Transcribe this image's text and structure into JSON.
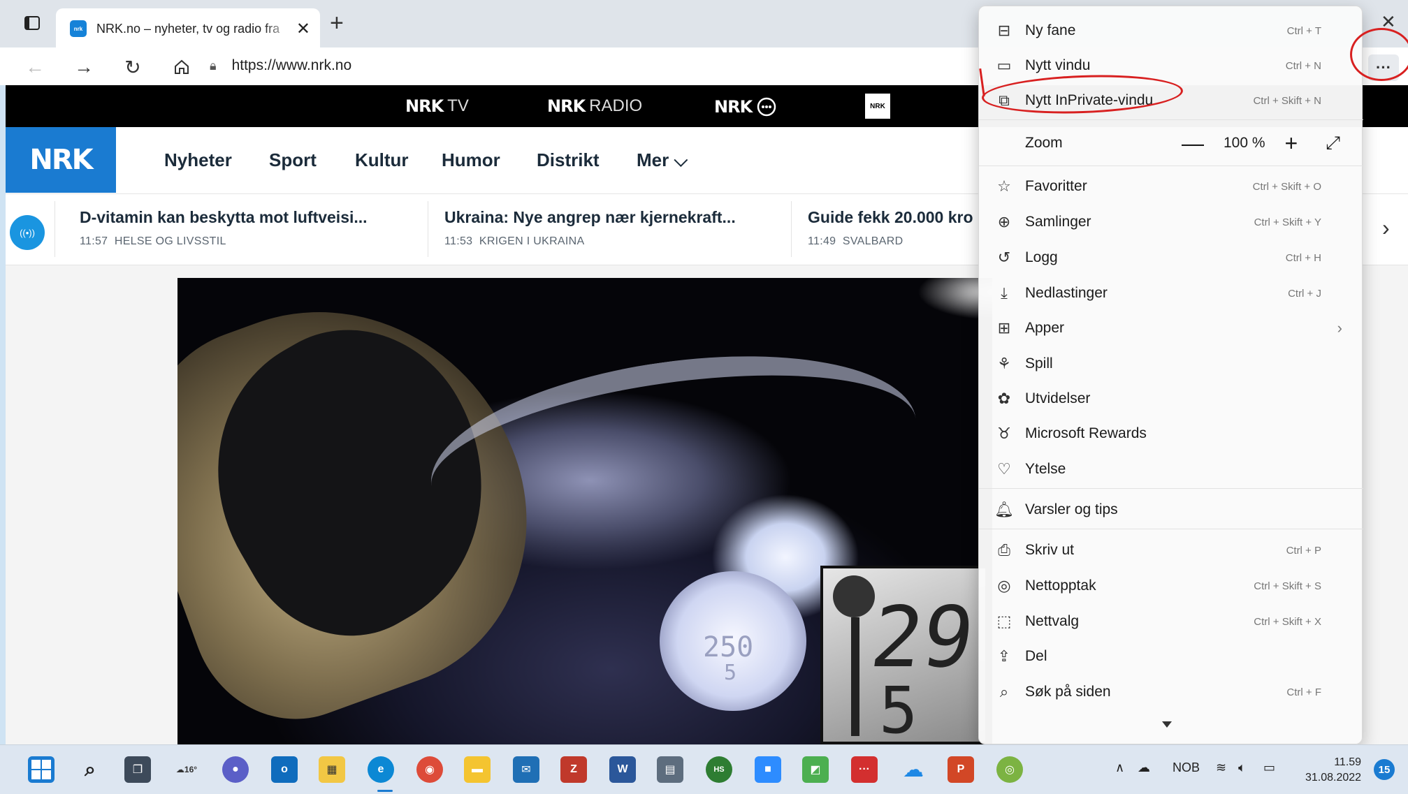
{
  "browser": {
    "tab_title": "NRK.no – nyheter, tv og radio fra",
    "url": "https://www.nrk.no",
    "more_label": "···",
    "new_tab_glyph": "+",
    "close_glyph": "✕"
  },
  "nrk_strip": {
    "tv": {
      "brand": "NRK",
      "label": "TV"
    },
    "radio": {
      "brand": "NRK",
      "label": "RADIO"
    },
    "super": {
      "brand": "NRK"
    }
  },
  "nrk_nav": {
    "logo": "NRK",
    "items": [
      "Nyheter",
      "Sport",
      "Kultur",
      "Humor",
      "Distrikt",
      "Mer ⌵"
    ]
  },
  "ticker": {
    "items": [
      {
        "headline": "D-vitamin kan beskytta mot luftveisi...",
        "time": "11:57",
        "category": "HELSE OG LIVSSTIL"
      },
      {
        "headline": "Ukraina: Nye angrep nær kjernekraft...",
        "time": "11:53",
        "category": "KRIGEN I UKRAINA"
      },
      {
        "headline": "Guide fekk 20.000 kro",
        "time": "11:49",
        "category": "SVALBARD"
      }
    ]
  },
  "video": {
    "lcd_speed": "29",
    "lcd_gear": "5",
    "inner_speed": "250",
    "inner_gear": "5"
  },
  "menu": {
    "items": [
      {
        "icon": "new-tab-icon",
        "label": "Ny fane",
        "shortcut": "Ctrl + T"
      },
      {
        "icon": "new-window-icon",
        "label": "Nytt vindu",
        "shortcut": "Ctrl + N"
      },
      {
        "icon": "inprivate-icon",
        "label": "Nytt InPrivate-vindu",
        "shortcut": "Ctrl + Skift + N"
      },
      {
        "icon": "",
        "label": "Zoom",
        "shortcut": ""
      },
      {
        "icon": "favorites-icon",
        "label": "Favoritter",
        "shortcut": "Ctrl + Skift + O"
      },
      {
        "icon": "collections-icon",
        "label": "Samlinger",
        "shortcut": "Ctrl + Skift + Y"
      },
      {
        "icon": "history-icon",
        "label": "Logg",
        "shortcut": "Ctrl + H"
      },
      {
        "icon": "downloads-icon",
        "label": "Nedlastinger",
        "shortcut": "Ctrl + J"
      },
      {
        "icon": "apps-icon",
        "label": "Apper",
        "shortcut": ""
      },
      {
        "icon": "games-icon",
        "label": "Spill",
        "shortcut": ""
      },
      {
        "icon": "extensions-icon",
        "label": "Utvidelser",
        "shortcut": ""
      },
      {
        "icon": "rewards-icon",
        "label": "Microsoft Rewards",
        "shortcut": ""
      },
      {
        "icon": "performance-icon",
        "label": "Ytelse",
        "shortcut": ""
      },
      {
        "icon": "bell-icon",
        "label": "Varsler og tips",
        "shortcut": ""
      },
      {
        "icon": "print-icon",
        "label": "Skriv ut",
        "shortcut": "Ctrl + P"
      },
      {
        "icon": "screenshot-icon",
        "label": "Nettopptak",
        "shortcut": "Ctrl + Skift + S"
      },
      {
        "icon": "web-select-icon",
        "label": "Nettvalg",
        "shortcut": "Ctrl + Skift + X"
      },
      {
        "icon": "share-icon",
        "label": "Del",
        "shortcut": ""
      },
      {
        "icon": "find-icon",
        "label": "Søk på siden",
        "shortcut": "Ctrl + F"
      }
    ],
    "zoom": {
      "minus": "—",
      "value": "100 %",
      "plus": "+",
      "fullscreen": "⤢"
    }
  },
  "taskbar": {
    "weather": "16°",
    "language": "NOB",
    "time": "11.59",
    "date": "31.08.2022",
    "notifications": "15"
  },
  "colors": {
    "nrk_blue": "#1a7bd1",
    "annotation_red": "#d82020"
  }
}
